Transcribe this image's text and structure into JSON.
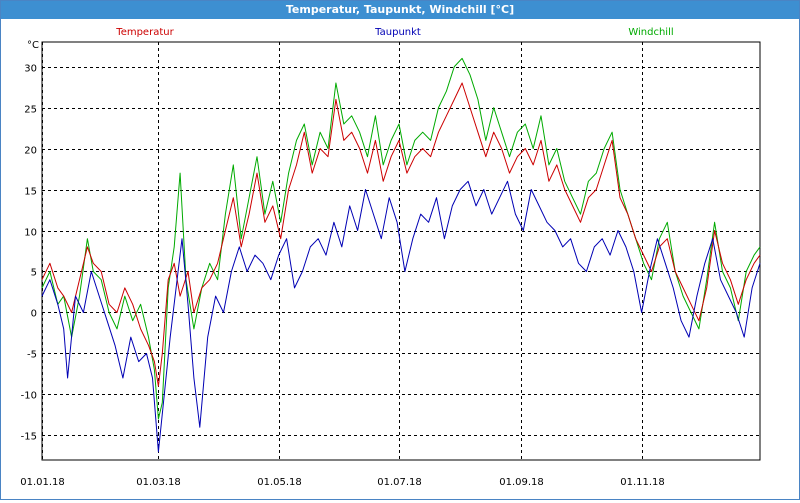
{
  "window": {
    "title": "Temperatur, Taupunkt, Windchill [°C]"
  },
  "chart_data": {
    "type": "line",
    "title": "Temperatur, Taupunkt, Windchill [°C]",
    "ylabel": "°C",
    "xlabel": "",
    "ylim": [
      -18,
      33
    ],
    "yticks": [
      30,
      25,
      20,
      15,
      10,
      5,
      0,
      -5,
      -10,
      -15
    ],
    "xlim": [
      "2018-01-01",
      "2018-12-31"
    ],
    "xticks": [
      "01.01.18",
      "01.03.18",
      "01.05.18",
      "01.07.18",
      "01.09.18",
      "01.11.18"
    ],
    "grid": true,
    "legend_position": "top",
    "series": [
      {
        "name": "Temperatur",
        "color": "#cc0000",
        "points": [
          [
            "2018-01-01",
            4
          ],
          [
            "2018-01-05",
            6
          ],
          [
            "2018-01-09",
            3
          ],
          [
            "2018-01-12",
            2
          ],
          [
            "2018-01-16",
            0
          ],
          [
            "2018-01-20",
            4
          ],
          [
            "2018-01-24",
            8
          ],
          [
            "2018-01-27",
            6
          ],
          [
            "2018-01-31",
            5
          ],
          [
            "2018-02-04",
            1
          ],
          [
            "2018-02-08",
            0
          ],
          [
            "2018-02-12",
            3
          ],
          [
            "2018-02-16",
            1
          ],
          [
            "2018-02-20",
            -2
          ],
          [
            "2018-02-24",
            -4
          ],
          [
            "2018-02-27",
            -6
          ],
          [
            "2018-03-01",
            -9
          ],
          [
            "2018-03-03",
            -5
          ],
          [
            "2018-03-06",
            4
          ],
          [
            "2018-03-09",
            6
          ],
          [
            "2018-03-12",
            2
          ],
          [
            "2018-03-16",
            5
          ],
          [
            "2018-03-19",
            0
          ],
          [
            "2018-03-23",
            3
          ],
          [
            "2018-03-27",
            4
          ],
          [
            "2018-03-31",
            6
          ],
          [
            "2018-04-04",
            10
          ],
          [
            "2018-04-08",
            14
          ],
          [
            "2018-04-12",
            8
          ],
          [
            "2018-04-16",
            12
          ],
          [
            "2018-04-20",
            17
          ],
          [
            "2018-04-24",
            11
          ],
          [
            "2018-04-28",
            13
          ],
          [
            "2018-05-02",
            9
          ],
          [
            "2018-05-06",
            15
          ],
          [
            "2018-05-10",
            18
          ],
          [
            "2018-05-14",
            22
          ],
          [
            "2018-05-18",
            17
          ],
          [
            "2018-05-22",
            20
          ],
          [
            "2018-05-26",
            19
          ],
          [
            "2018-05-30",
            26
          ],
          [
            "2018-06-03",
            21
          ],
          [
            "2018-06-07",
            22
          ],
          [
            "2018-06-11",
            20
          ],
          [
            "2018-06-15",
            17
          ],
          [
            "2018-06-19",
            21
          ],
          [
            "2018-06-23",
            16
          ],
          [
            "2018-06-27",
            19
          ],
          [
            "2018-07-01",
            21
          ],
          [
            "2018-07-05",
            17
          ],
          [
            "2018-07-09",
            19
          ],
          [
            "2018-07-13",
            20
          ],
          [
            "2018-07-17",
            19
          ],
          [
            "2018-07-21",
            22
          ],
          [
            "2018-07-25",
            24
          ],
          [
            "2018-07-29",
            26
          ],
          [
            "2018-08-02",
            28
          ],
          [
            "2018-08-06",
            25
          ],
          [
            "2018-08-10",
            22
          ],
          [
            "2018-08-14",
            19
          ],
          [
            "2018-08-18",
            22
          ],
          [
            "2018-08-22",
            20
          ],
          [
            "2018-08-26",
            17
          ],
          [
            "2018-08-30",
            19
          ],
          [
            "2018-09-03",
            20
          ],
          [
            "2018-09-07",
            18
          ],
          [
            "2018-09-11",
            21
          ],
          [
            "2018-09-15",
            16
          ],
          [
            "2018-09-19",
            18
          ],
          [
            "2018-09-23",
            15
          ],
          [
            "2018-09-27",
            13
          ],
          [
            "2018-10-01",
            11
          ],
          [
            "2018-10-05",
            14
          ],
          [
            "2018-10-09",
            15
          ],
          [
            "2018-10-13",
            18
          ],
          [
            "2018-10-17",
            21
          ],
          [
            "2018-10-21",
            14
          ],
          [
            "2018-10-25",
            12
          ],
          [
            "2018-10-29",
            9
          ],
          [
            "2018-11-02",
            7
          ],
          [
            "2018-11-06",
            5
          ],
          [
            "2018-11-10",
            8
          ],
          [
            "2018-11-14",
            9
          ],
          [
            "2018-11-18",
            5
          ],
          [
            "2018-11-22",
            3
          ],
          [
            "2018-11-26",
            1
          ],
          [
            "2018-11-30",
            -1
          ],
          [
            "2018-12-04",
            3
          ],
          [
            "2018-12-08",
            10
          ],
          [
            "2018-12-12",
            6
          ],
          [
            "2018-12-16",
            4
          ],
          [
            "2018-12-20",
            1
          ],
          [
            "2018-12-24",
            4
          ],
          [
            "2018-12-28",
            6
          ],
          [
            "2018-12-31",
            7
          ]
        ]
      },
      {
        "name": "Taupunkt",
        "color": "#0000b4",
        "points": [
          [
            "2018-01-01",
            2
          ],
          [
            "2018-01-05",
            4
          ],
          [
            "2018-01-09",
            1
          ],
          [
            "2018-01-12",
            -2
          ],
          [
            "2018-01-14",
            -8
          ],
          [
            "2018-01-18",
            2
          ],
          [
            "2018-01-22",
            0
          ],
          [
            "2018-01-26",
            5
          ],
          [
            "2018-01-30",
            2
          ],
          [
            "2018-02-03",
            -1
          ],
          [
            "2018-02-07",
            -4
          ],
          [
            "2018-02-11",
            -8
          ],
          [
            "2018-02-15",
            -3
          ],
          [
            "2018-02-19",
            -6
          ],
          [
            "2018-02-23",
            -5
          ],
          [
            "2018-02-26",
            -8
          ],
          [
            "2018-03-01",
            -17
          ],
          [
            "2018-03-04",
            -10
          ],
          [
            "2018-03-07",
            -3
          ],
          [
            "2018-03-10",
            3
          ],
          [
            "2018-03-13",
            9
          ],
          [
            "2018-03-16",
            1
          ],
          [
            "2018-03-19",
            -8
          ],
          [
            "2018-03-22",
            -14
          ],
          [
            "2018-03-26",
            -3
          ],
          [
            "2018-03-30",
            2
          ],
          [
            "2018-04-03",
            0
          ],
          [
            "2018-04-07",
            5
          ],
          [
            "2018-04-11",
            8
          ],
          [
            "2018-04-15",
            5
          ],
          [
            "2018-04-19",
            7
          ],
          [
            "2018-04-23",
            6
          ],
          [
            "2018-04-27",
            4
          ],
          [
            "2018-05-01",
            7
          ],
          [
            "2018-05-05",
            9
          ],
          [
            "2018-05-09",
            3
          ],
          [
            "2018-05-13",
            5
          ],
          [
            "2018-05-17",
            8
          ],
          [
            "2018-05-21",
            9
          ],
          [
            "2018-05-25",
            7
          ],
          [
            "2018-05-29",
            11
          ],
          [
            "2018-06-02",
            8
          ],
          [
            "2018-06-06",
            13
          ],
          [
            "2018-06-10",
            10
          ],
          [
            "2018-06-14",
            15
          ],
          [
            "2018-06-18",
            12
          ],
          [
            "2018-06-22",
            9
          ],
          [
            "2018-06-26",
            14
          ],
          [
            "2018-06-30",
            11
          ],
          [
            "2018-07-04",
            5
          ],
          [
            "2018-07-08",
            9
          ],
          [
            "2018-07-12",
            12
          ],
          [
            "2018-07-16",
            11
          ],
          [
            "2018-07-20",
            14
          ],
          [
            "2018-07-24",
            9
          ],
          [
            "2018-07-28",
            13
          ],
          [
            "2018-08-01",
            15
          ],
          [
            "2018-08-05",
            16
          ],
          [
            "2018-08-09",
            13
          ],
          [
            "2018-08-13",
            15
          ],
          [
            "2018-08-17",
            12
          ],
          [
            "2018-08-21",
            14
          ],
          [
            "2018-08-25",
            16
          ],
          [
            "2018-08-29",
            12
          ],
          [
            "2018-09-02",
            10
          ],
          [
            "2018-09-06",
            15
          ],
          [
            "2018-09-10",
            13
          ],
          [
            "2018-09-14",
            11
          ],
          [
            "2018-09-18",
            10
          ],
          [
            "2018-09-22",
            8
          ],
          [
            "2018-09-26",
            9
          ],
          [
            "2018-09-30",
            6
          ],
          [
            "2018-10-04",
            5
          ],
          [
            "2018-10-08",
            8
          ],
          [
            "2018-10-12",
            9
          ],
          [
            "2018-10-16",
            7
          ],
          [
            "2018-10-20",
            10
          ],
          [
            "2018-10-24",
            8
          ],
          [
            "2018-10-28",
            5
          ],
          [
            "2018-11-01",
            0
          ],
          [
            "2018-11-05",
            5
          ],
          [
            "2018-11-09",
            9
          ],
          [
            "2018-11-13",
            6
          ],
          [
            "2018-11-17",
            3
          ],
          [
            "2018-11-21",
            -1
          ],
          [
            "2018-11-25",
            -3
          ],
          [
            "2018-11-29",
            2
          ],
          [
            "2018-12-03",
            6
          ],
          [
            "2018-12-07",
            9
          ],
          [
            "2018-12-11",
            4
          ],
          [
            "2018-12-15",
            2
          ],
          [
            "2018-12-19",
            0
          ],
          [
            "2018-12-23",
            -3
          ],
          [
            "2018-12-27",
            3
          ],
          [
            "2018-12-31",
            6
          ]
        ]
      },
      {
        "name": "Windchill",
        "color": "#00aa00",
        "points": [
          [
            "2018-01-01",
            3
          ],
          [
            "2018-01-05",
            5
          ],
          [
            "2018-01-09",
            1
          ],
          [
            "2018-01-12",
            2
          ],
          [
            "2018-01-16",
            -3
          ],
          [
            "2018-01-20",
            2
          ],
          [
            "2018-01-24",
            9
          ],
          [
            "2018-01-27",
            5
          ],
          [
            "2018-01-31",
            4
          ],
          [
            "2018-02-04",
            0
          ],
          [
            "2018-02-08",
            -2
          ],
          [
            "2018-02-12",
            2
          ],
          [
            "2018-02-16",
            -1
          ],
          [
            "2018-02-20",
            1
          ],
          [
            "2018-02-24",
            -3
          ],
          [
            "2018-02-27",
            -7
          ],
          [
            "2018-03-01",
            -13
          ],
          [
            "2018-03-03",
            -11
          ],
          [
            "2018-03-06",
            3
          ],
          [
            "2018-03-09",
            8
          ],
          [
            "2018-03-12",
            17
          ],
          [
            "2018-03-15",
            4
          ],
          [
            "2018-03-19",
            -2
          ],
          [
            "2018-03-23",
            3
          ],
          [
            "2018-03-27",
            6
          ],
          [
            "2018-03-31",
            4
          ],
          [
            "2018-04-04",
            12
          ],
          [
            "2018-04-08",
            18
          ],
          [
            "2018-04-12",
            9
          ],
          [
            "2018-04-16",
            14
          ],
          [
            "2018-04-20",
            19
          ],
          [
            "2018-04-24",
            12
          ],
          [
            "2018-04-28",
            16
          ],
          [
            "2018-05-02",
            11
          ],
          [
            "2018-05-06",
            17
          ],
          [
            "2018-05-10",
            21
          ],
          [
            "2018-05-14",
            23
          ],
          [
            "2018-05-18",
            18
          ],
          [
            "2018-05-22",
            22
          ],
          [
            "2018-05-26",
            20
          ],
          [
            "2018-05-30",
            28
          ],
          [
            "2018-06-03",
            23
          ],
          [
            "2018-06-07",
            24
          ],
          [
            "2018-06-11",
            22
          ],
          [
            "2018-06-15",
            19
          ],
          [
            "2018-06-19",
            24
          ],
          [
            "2018-06-23",
            18
          ],
          [
            "2018-06-27",
            21
          ],
          [
            "2018-07-01",
            23
          ],
          [
            "2018-07-05",
            18
          ],
          [
            "2018-07-09",
            21
          ],
          [
            "2018-07-13",
            22
          ],
          [
            "2018-07-17",
            21
          ],
          [
            "2018-07-21",
            25
          ],
          [
            "2018-07-25",
            27
          ],
          [
            "2018-07-29",
            30
          ],
          [
            "2018-08-02",
            31
          ],
          [
            "2018-08-06",
            29
          ],
          [
            "2018-08-10",
            26
          ],
          [
            "2018-08-14",
            21
          ],
          [
            "2018-08-18",
            25
          ],
          [
            "2018-08-22",
            22
          ],
          [
            "2018-08-26",
            19
          ],
          [
            "2018-08-30",
            22
          ],
          [
            "2018-09-03",
            23
          ],
          [
            "2018-09-07",
            20
          ],
          [
            "2018-09-11",
            24
          ],
          [
            "2018-09-15",
            18
          ],
          [
            "2018-09-19",
            20
          ],
          [
            "2018-09-23",
            16
          ],
          [
            "2018-09-27",
            14
          ],
          [
            "2018-10-01",
            12
          ],
          [
            "2018-10-05",
            16
          ],
          [
            "2018-10-09",
            17
          ],
          [
            "2018-10-13",
            20
          ],
          [
            "2018-10-17",
            22
          ],
          [
            "2018-10-21",
            15
          ],
          [
            "2018-10-25",
            12
          ],
          [
            "2018-10-29",
            9
          ],
          [
            "2018-11-02",
            6
          ],
          [
            "2018-11-06",
            4
          ],
          [
            "2018-11-10",
            9
          ],
          [
            "2018-11-14",
            11
          ],
          [
            "2018-11-18",
            5
          ],
          [
            "2018-11-22",
            2
          ],
          [
            "2018-11-26",
            0
          ],
          [
            "2018-11-30",
            -2
          ],
          [
            "2018-12-04",
            4
          ],
          [
            "2018-12-08",
            11
          ],
          [
            "2018-12-12",
            5
          ],
          [
            "2018-12-16",
            3
          ],
          [
            "2018-12-20",
            -1
          ],
          [
            "2018-12-24",
            5
          ],
          [
            "2018-12-28",
            7
          ],
          [
            "2018-12-31",
            8
          ]
        ]
      }
    ]
  }
}
